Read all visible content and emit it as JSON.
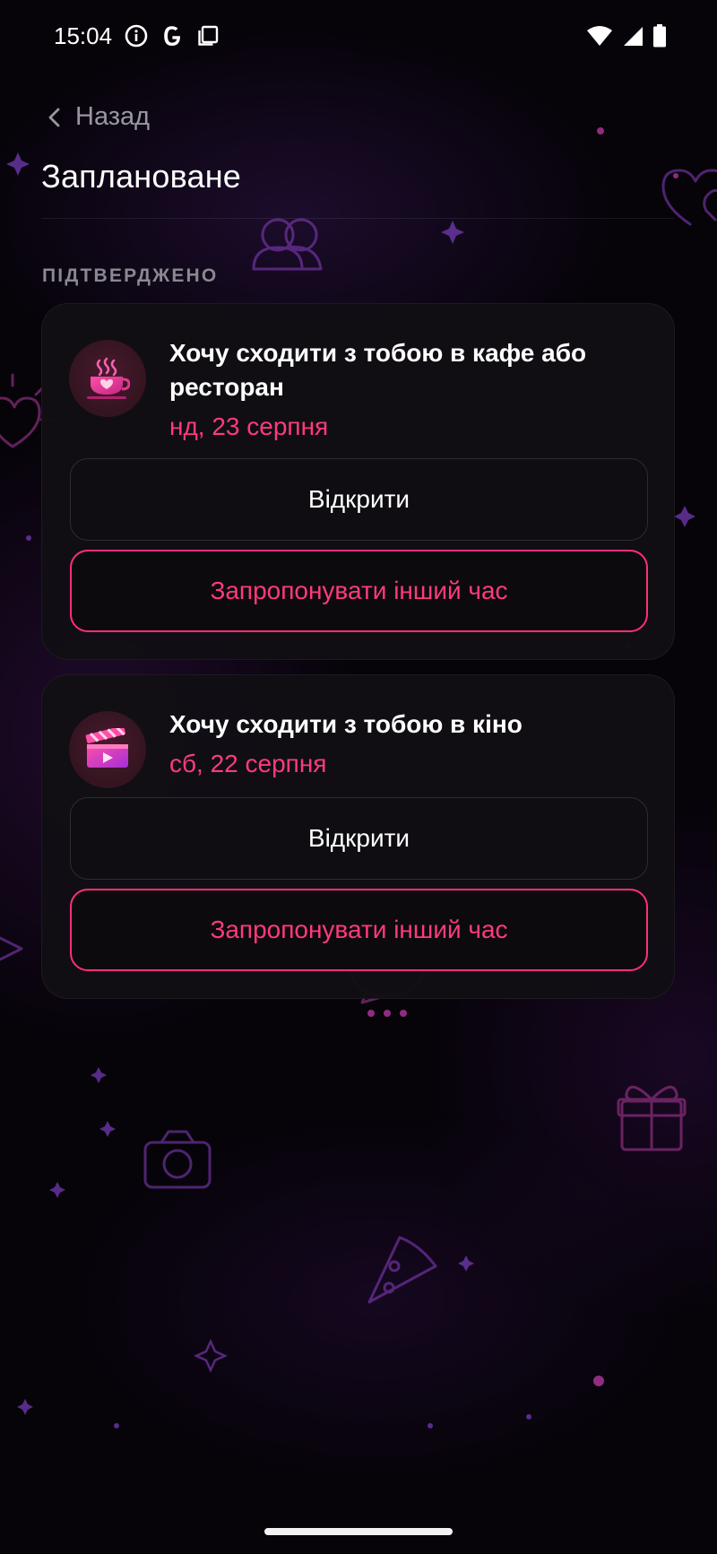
{
  "status_bar": {
    "time": "15:04",
    "left_icons": [
      "info-icon",
      "google-icon",
      "copy-icon"
    ],
    "right_icons": [
      "wifi-icon",
      "cell-signal-icon",
      "battery-icon"
    ]
  },
  "header": {
    "back_label": "Назад",
    "title": "Заплановане"
  },
  "section": {
    "label": "ПІДТВЕРДЖЕНО"
  },
  "cards": [
    {
      "icon": "coffee-cup-icon",
      "title": "Хочу сходити з тобою в кафе або ресторан",
      "date": "нд, 23 серпня",
      "open_label": "Відкрити",
      "reschedule_label": "Запропонувати інший час"
    },
    {
      "icon": "clapperboard-icon",
      "title": "Хочу сходити з тобою в кіно",
      "date": "сб, 22 серпня",
      "open_label": "Відкрити",
      "reschedule_label": "Запропонувати інший час"
    }
  ],
  "colors": {
    "accent": "#ff3a7d",
    "background": "#060309",
    "card": "#110f14",
    "muted_text": "#8a8890"
  }
}
